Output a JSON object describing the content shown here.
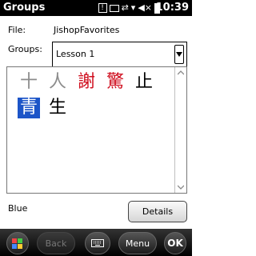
{
  "status_bar": {
    "title": "Groups",
    "time": "10:39",
    "icons": [
      "notification-icon",
      "message-icon",
      "sync-icon",
      "signal-icon",
      "volume-muted-icon",
      "battery-icon"
    ]
  },
  "form": {
    "file_label": "File:",
    "file_value": "JishopFavorites",
    "groups_label": "Groups:",
    "groups_selected": "Lesson 1"
  },
  "kanji_grid": {
    "rows": [
      [
        {
          "char": "十",
          "color": "#8c8c8c",
          "selected": false
        },
        {
          "char": "人",
          "color": "#8c8c8c",
          "selected": false
        },
        {
          "char": "謝",
          "color": "#d01020",
          "selected": false
        },
        {
          "char": "驚",
          "color": "#d01020",
          "selected": false
        },
        {
          "char": "止",
          "color": "#000000",
          "selected": false
        }
      ],
      [
        {
          "char": "青",
          "color": "#ffffff",
          "selected": true
        },
        {
          "char": "生",
          "color": "#000000",
          "selected": false
        }
      ]
    ],
    "selection_color": "#1c55c8"
  },
  "selected_color_name": "Blue",
  "details_button": "Details",
  "soft_keys": {
    "start_icon": "windows-start-icon",
    "back": "Back",
    "keyboard_icon": "keyboard-icon",
    "menu": "Menu",
    "ok": "OK"
  }
}
